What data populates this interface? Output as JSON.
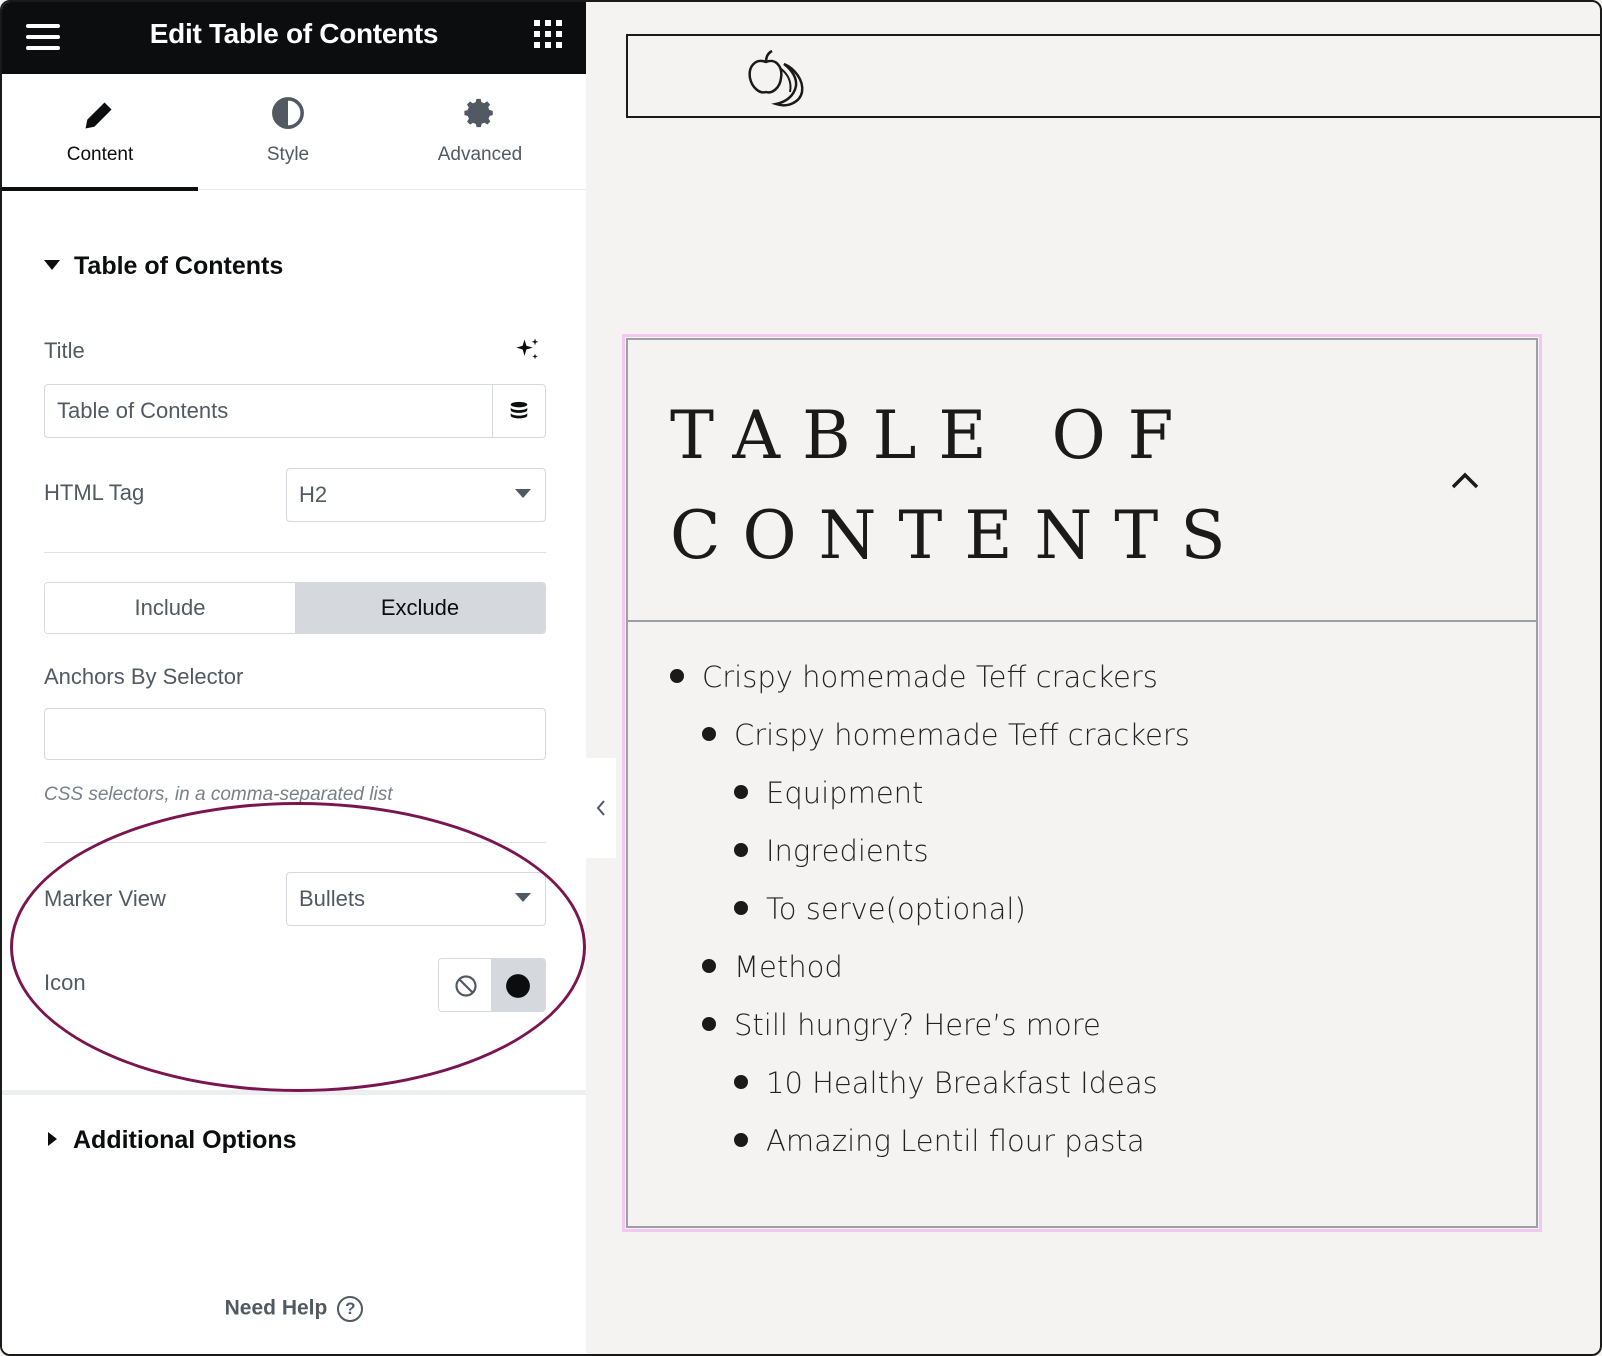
{
  "topbar": {
    "title": "Edit Table of Contents"
  },
  "tabs": [
    {
      "label": "Content",
      "icon": "pencil-icon",
      "active": true
    },
    {
      "label": "Style",
      "icon": "half-circle-icon",
      "active": false
    },
    {
      "label": "Advanced",
      "icon": "gear-icon",
      "active": false
    }
  ],
  "section": {
    "title": "Table of Contents"
  },
  "title_field": {
    "label": "Title",
    "value": "Table of Contents"
  },
  "html_tag": {
    "label": "HTML Tag",
    "value": "H2"
  },
  "segmented": {
    "include": "Include",
    "exclude": "Exclude",
    "selected": "Exclude"
  },
  "anchors": {
    "label": "Anchors By Selector",
    "value": "",
    "help": "CSS selectors, in a comma-separated list"
  },
  "marker_view": {
    "label": "Marker View",
    "value": "Bullets"
  },
  "icon_field": {
    "label": "Icon",
    "selected": "dot-icon"
  },
  "additional": {
    "title": "Additional Options"
  },
  "help": {
    "label": "Need Help",
    "icon": "question-icon"
  },
  "preview": {
    "toc_title": "Table of Contents",
    "items": [
      {
        "text": "Crispy homemade Teff crackers",
        "level": 0
      },
      {
        "text": "Crispy homemade Teff crackers",
        "level": 1
      },
      {
        "text": "Equipment",
        "level": 2
      },
      {
        "text": "Ingredients",
        "level": 2
      },
      {
        "text": "To serve(optional)",
        "level": 2
      },
      {
        "text": "Method",
        "level": 1
      },
      {
        "text": "Still hungry? Here’s more",
        "level": 1
      },
      {
        "text": "10 Healthy Breakfast Ideas",
        "level": 2
      },
      {
        "text": "Amazing Lentil flour pasta",
        "level": 2
      }
    ]
  },
  "colors": {
    "topbar": "#0c0d0e",
    "highlight_ellipse": "#7a1550",
    "selection_outline": "#f0c8f0",
    "canvas": "#f4f3f1"
  }
}
